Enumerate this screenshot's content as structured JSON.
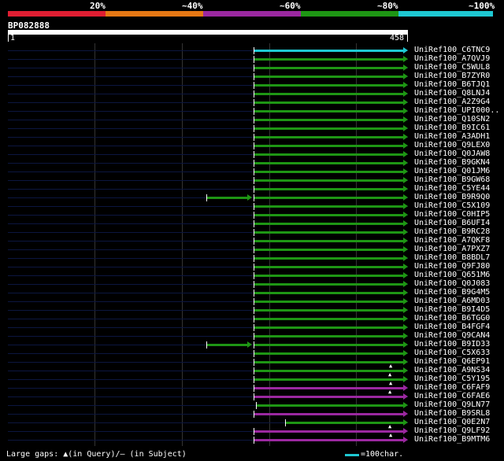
{
  "scale": {
    "labels": [
      "20%",
      "~40%",
      "~60%",
      "~80%",
      "~100%"
    ],
    "colors": [
      "#e01e32",
      "#e67814",
      "#9b28a0",
      "#1e9614",
      "#1ec8d2"
    ]
  },
  "query": {
    "title": "BP082888",
    "start": "1",
    "end": "458"
  },
  "hits": [
    {
      "name": "UniRef100_C6TNC9",
      "from": 1,
      "to": 458,
      "color": "cyan"
    },
    {
      "name": "UniRef100_A7QVJ9",
      "from": 1,
      "to": 458,
      "color": "green"
    },
    {
      "name": "UniRef100_C5WUL8",
      "from": 1,
      "to": 458,
      "color": "green"
    },
    {
      "name": "UniRef100_B7ZYR0",
      "from": 1,
      "to": 458,
      "color": "green"
    },
    {
      "name": "UniRef100_B6TJQ1",
      "from": 1,
      "to": 458,
      "color": "green"
    },
    {
      "name": "UniRef100_Q8LNJ4",
      "from": 1,
      "to": 458,
      "color": "green"
    },
    {
      "name": "UniRef100_A2Z9G4",
      "from": 1,
      "to": 458,
      "color": "green"
    },
    {
      "name": "UniRef100_UPI000..",
      "from": 1,
      "to": 458,
      "color": "green"
    },
    {
      "name": "UniRef100_Q10SN2",
      "from": 1,
      "to": 458,
      "color": "green"
    },
    {
      "name": "UniRef100_B9IC61",
      "from": 1,
      "to": 458,
      "color": "green"
    },
    {
      "name": "UniRef100_A3ADH1",
      "from": 1,
      "to": 458,
      "color": "green"
    },
    {
      "name": "UniRef100_Q9LEX0",
      "from": 1,
      "to": 458,
      "color": "green"
    },
    {
      "name": "UniRef100_Q0JAW8",
      "from": 1,
      "to": 458,
      "color": "green"
    },
    {
      "name": "UniRef100_B9GKN4",
      "from": 1,
      "to": 458,
      "color": "green"
    },
    {
      "name": "UniRef100_Q01JM6",
      "from": 1,
      "to": 458,
      "color": "green"
    },
    {
      "name": "UniRef100_B9GW68",
      "from": 1,
      "to": 458,
      "color": "green"
    },
    {
      "name": "UniRef100_C5YE44",
      "from": 1,
      "to": 458,
      "color": "green"
    },
    {
      "name": "UniRef100_B9R9Q0",
      "from": 1,
      "to": 458,
      "color": "green",
      "extra": {
        "from": 278,
        "to": 338
      }
    },
    {
      "name": "UniRef100_C5X109",
      "from": 1,
      "to": 458,
      "color": "green"
    },
    {
      "name": "UniRef100_C0HIP5",
      "from": 1,
      "to": 458,
      "color": "green"
    },
    {
      "name": "UniRef100_B6UFI4",
      "from": 1,
      "to": 458,
      "color": "green"
    },
    {
      "name": "UniRef100_B9RC28",
      "from": 1,
      "to": 458,
      "color": "green"
    },
    {
      "name": "UniRef100_A7QKF8",
      "from": 1,
      "to": 458,
      "color": "green"
    },
    {
      "name": "UniRef100_A7PXZ7",
      "from": 1,
      "to": 458,
      "color": "green"
    },
    {
      "name": "UniRef100_B8BDL7",
      "from": 1,
      "to": 458,
      "color": "green"
    },
    {
      "name": "UniRef100_Q9FJ80",
      "from": 1,
      "to": 458,
      "color": "green"
    },
    {
      "name": "UniRef100_Q651M6",
      "from": 1,
      "to": 458,
      "color": "green"
    },
    {
      "name": "UniRef100_Q0J083",
      "from": 1,
      "to": 458,
      "color": "green"
    },
    {
      "name": "UniRef100_B9G4M5",
      "from": 1,
      "to": 458,
      "color": "green"
    },
    {
      "name": "UniRef100_A6MD03",
      "from": 1,
      "to": 458,
      "color": "green"
    },
    {
      "name": "UniRef100_B9I4D5",
      "from": 1,
      "to": 458,
      "color": "green"
    },
    {
      "name": "UniRef100_B6TGG0",
      "from": 1,
      "to": 458,
      "color": "green"
    },
    {
      "name": "UniRef100_B4FGF4",
      "from": 1,
      "to": 458,
      "color": "green"
    },
    {
      "name": "UniRef100_Q9CAN4",
      "from": 1,
      "to": 458,
      "color": "green"
    },
    {
      "name": "UniRef100_B9ID33",
      "from": 1,
      "to": 458,
      "color": "green",
      "extra": {
        "from": 278,
        "to": 338
      }
    },
    {
      "name": "UniRef100_C5X633",
      "from": 1,
      "to": 458,
      "color": "green"
    },
    {
      "name": "UniRef100_Q6EP91",
      "from": 1,
      "to": 458,
      "color": "green"
    },
    {
      "name": "UniRef100_A9NS34",
      "from": 1,
      "to": 458,
      "color": "green",
      "gap": true
    },
    {
      "name": "UniRef100_C5Y195",
      "from": 1,
      "to": 458,
      "color": "green",
      "gap": true
    },
    {
      "name": "UniRef100_C6FAF9",
      "from": 1,
      "to": 458,
      "color": "purple",
      "gap": true
    },
    {
      "name": "UniRef100_C6FAE6",
      "from": 1,
      "to": 458,
      "color": "purple",
      "gap": true
    },
    {
      "name": "UniRef100_Q9LN77",
      "from": 4,
      "to": 458,
      "color": "green"
    },
    {
      "name": "UniRef100_B9SRL8",
      "from": 1,
      "to": 458,
      "color": "purple"
    },
    {
      "name": "UniRef100_Q0E2N7",
      "from": 41,
      "to": 458,
      "color": "green"
    },
    {
      "name": "UniRef100_Q9LF92",
      "from": 1,
      "to": 458,
      "color": "purple",
      "gap": true
    },
    {
      "name": "UniRef100_B9MTM6",
      "from": 1,
      "to": 458,
      "color": "purple",
      "gap": true
    }
  ],
  "footer": {
    "text": "Large gaps: ▲(in Query)/– (in Subject)",
    "legend": "=100char."
  }
}
